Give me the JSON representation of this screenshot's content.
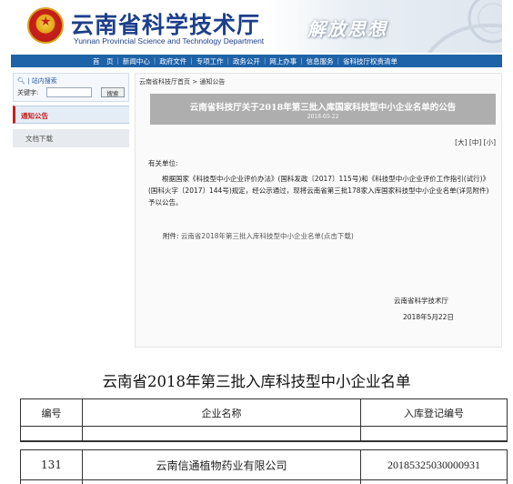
{
  "header": {
    "site_title": "云南省科学技术厅",
    "site_subtitle": "Yunnan Provincial Science and Technology Department",
    "slogan": "解放思想"
  },
  "nav": {
    "items": [
      "首　页",
      "新闻中心",
      "政府文件",
      "专项工作",
      "政务公开",
      "网上办事",
      "信息服务",
      "省科技厅权责清单"
    ]
  },
  "sidebar": {
    "search_title": "站内搜索",
    "keyword_label": "关键字:",
    "search_button": "搜索",
    "items": [
      {
        "label": "通知公告",
        "active": true
      },
      {
        "label": "文档下载",
        "active": false
      }
    ]
  },
  "breadcrumb": "云南省科技厅首页 > 通知公告",
  "article": {
    "title": "云南省科技厅关于2018年第三批入库国家科技型中小企业名单的公告",
    "date": "2018-05-22",
    "size_links": "[大]  [中]  [小]",
    "salutation": "有关单位:",
    "body": "根据国家《科技型中小企业评价办法》(国科发政〔2017〕115号)和《科技型中小企业评价工作指引(试行)》(国科火字〔2017〕144号)规定，经公示通过，现将云南省第三批178家入库国家科技型中小企业名单(详见附件)予以公告。",
    "attachment_label": "附件:",
    "attachment_link": "云南省2018年第三批入库科技型中小企业名单(点击下载)",
    "signer": "云南省科学技术厅",
    "sign_date": "2018年5月22日"
  },
  "list": {
    "title": "云南省2018年第三批入库科技型中小企业名单",
    "columns": [
      "编号",
      "企业名称",
      "入库登记编号"
    ],
    "rows": [
      {
        "no": "131",
        "name": "云南信通植物药业有限公司",
        "reg": "20185325030000931"
      }
    ]
  },
  "colors": {
    "nav_bg": "#1e62a8",
    "title_blue": "#1c3f8a",
    "active_red": "#c8201c",
    "article_head_bg": "#aeaeae"
  }
}
